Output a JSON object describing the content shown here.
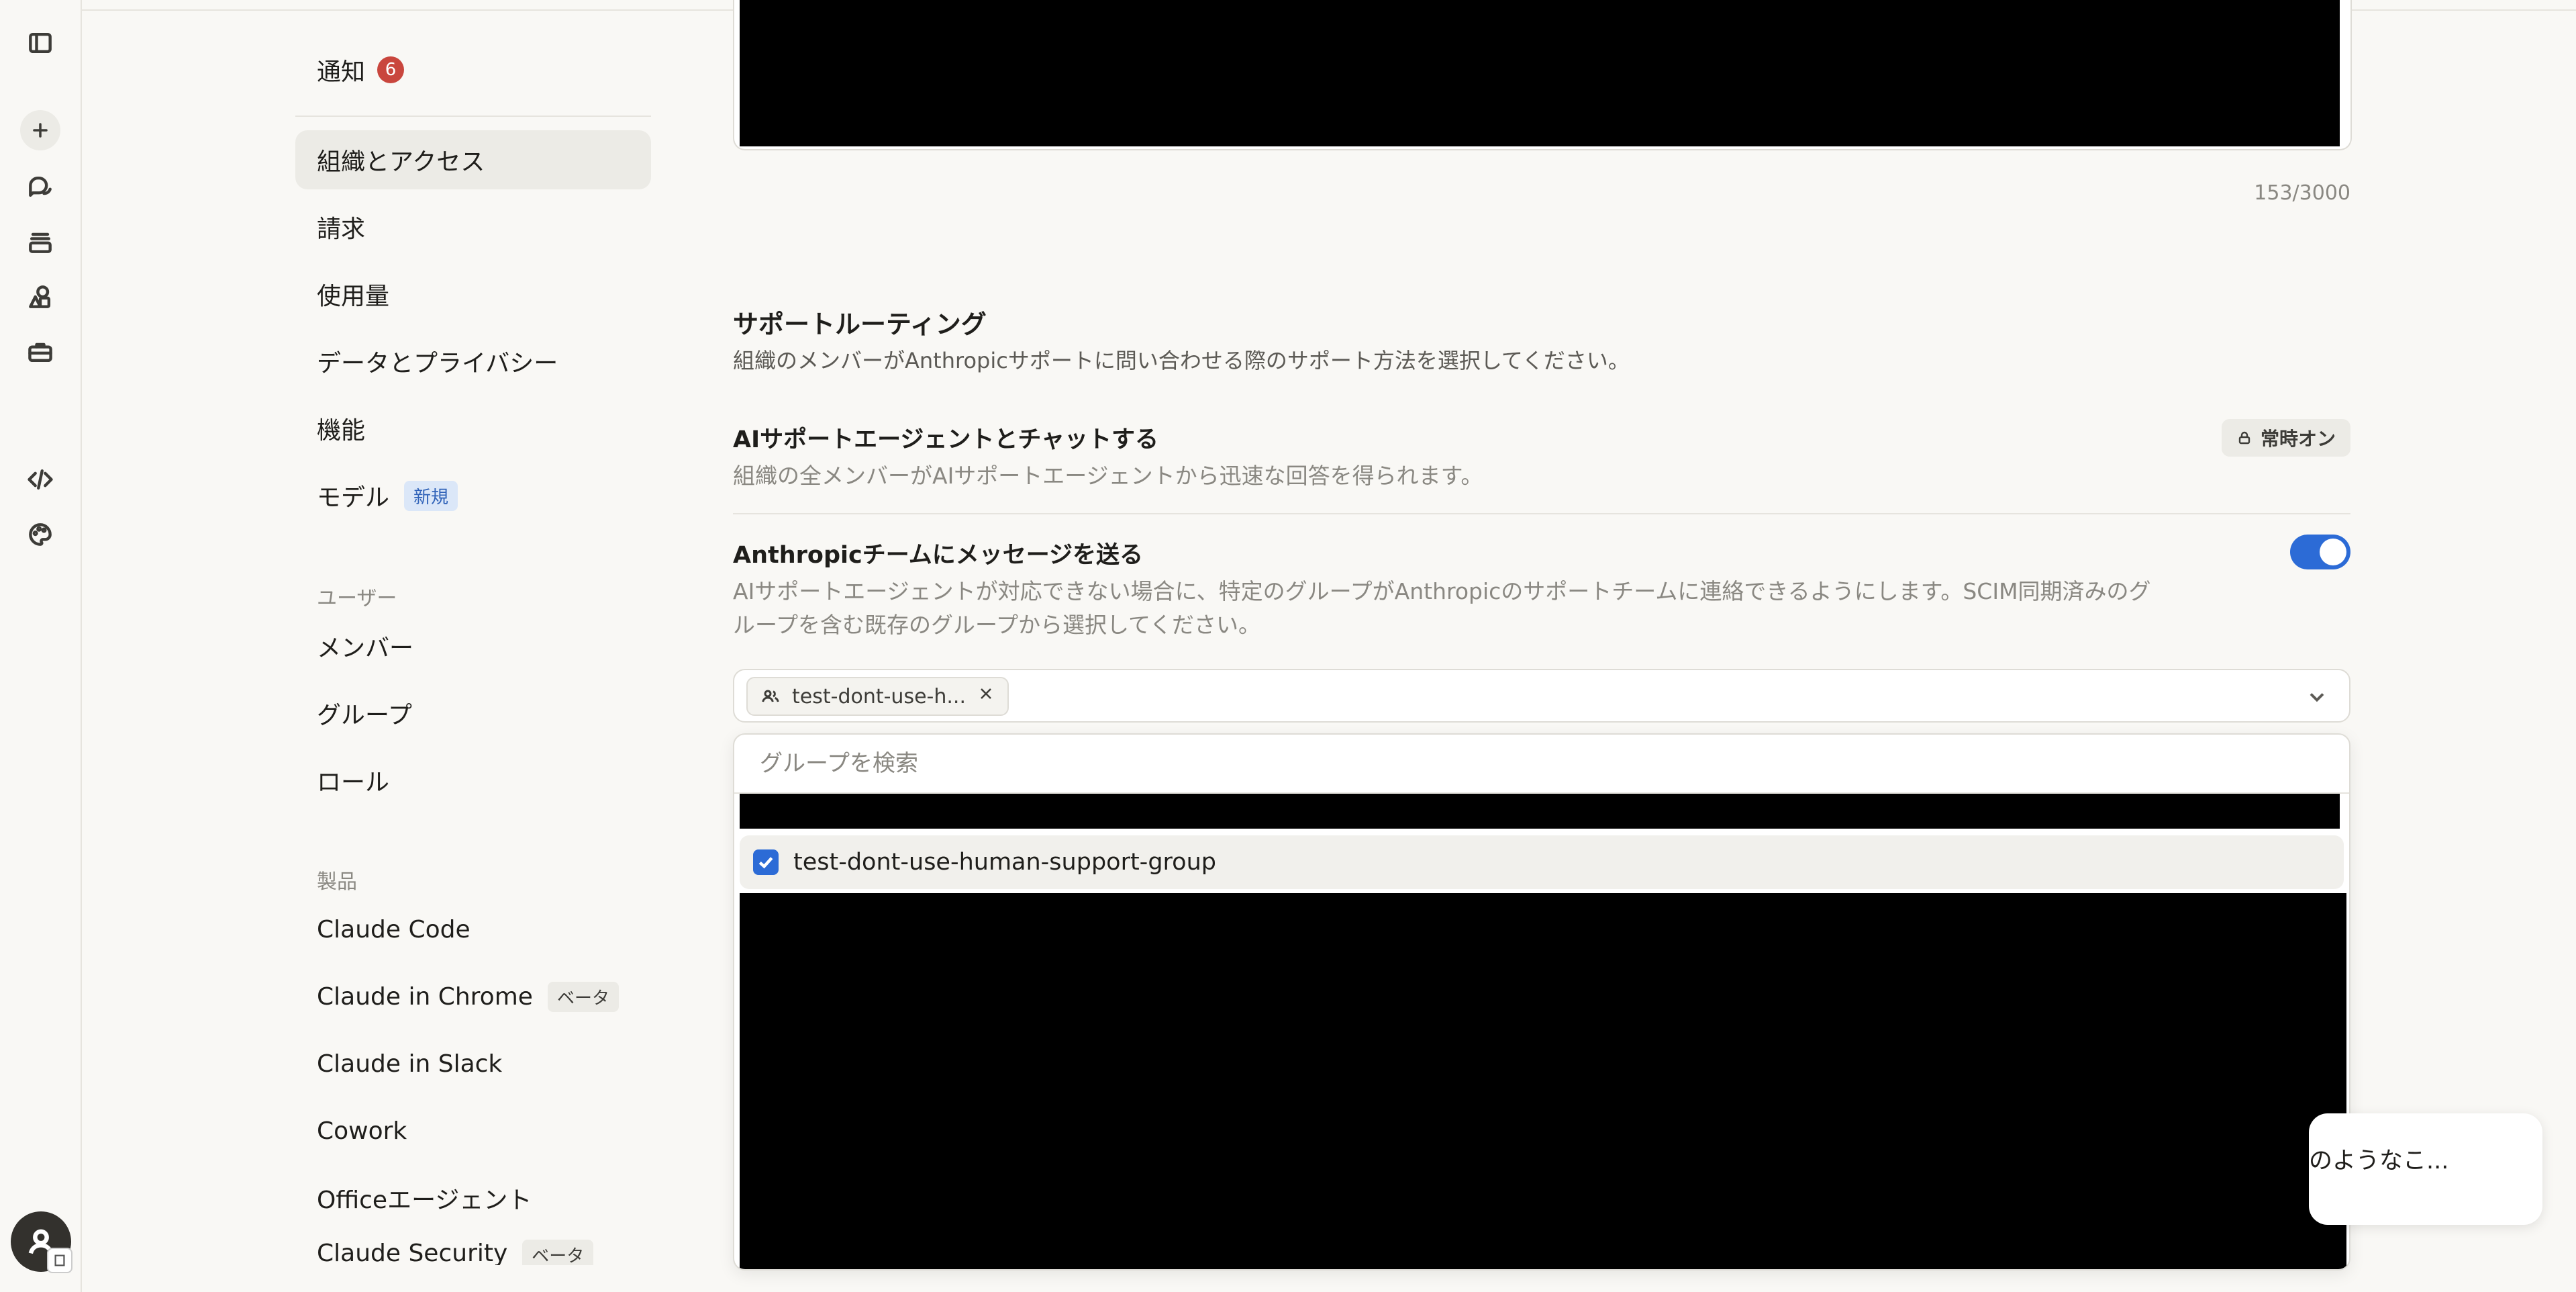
{
  "nav": {
    "notifications": {
      "label": "通知",
      "count": "6"
    },
    "items": [
      {
        "label": "組織とアクセス"
      },
      {
        "label": "請求"
      },
      {
        "label": "使用量"
      },
      {
        "label": "データとプライバシー"
      },
      {
        "label": "機能"
      },
      {
        "label": "モデル",
        "badge": "新規"
      }
    ],
    "users_heading": "ユーザー",
    "user_items": [
      {
        "label": "メンバー"
      },
      {
        "label": "グループ"
      },
      {
        "label": "ロール"
      }
    ],
    "products_heading": "製品",
    "product_items": [
      {
        "label": "Claude Code"
      },
      {
        "label": "Claude in Chrome",
        "badge": "ベータ"
      },
      {
        "label": "Claude in Slack"
      },
      {
        "label": "Cowork"
      },
      {
        "label": "Officeエージェント"
      },
      {
        "label": "Claude Security",
        "badge": "ベータ"
      }
    ]
  },
  "content": {
    "char_count": "153/3000",
    "support_routing": {
      "title": "サポートルーティング",
      "description": "組織のメンバーがAnthropicサポートに問い合わせる際のサポート方法を選択してください。"
    },
    "ai_agent": {
      "title": "AIサポートエージェントとチャットする",
      "description": "組織の全メンバーがAIサポートエージェントから迅速な回答を得られます。",
      "status": "常時オン"
    },
    "message_team": {
      "title": "Anthropicチームにメッセージを送る",
      "description_line1": "AIサポートエージェントが対応できない場合に、特定のグループがAnthropicのサポートチームに連絡できるようにします。SCIM同期済みのグ",
      "description_line2": "ループを含む既存のグループから選択してください。",
      "enabled": true
    },
    "group_select": {
      "selected_chip": "test-dont-use-h...",
      "search_placeholder": "グループを検索",
      "options": [
        {
          "label": "test-dont-use-human-support-group",
          "checked": true
        }
      ]
    }
  },
  "toast": {
    "text": "のようなこ..."
  }
}
